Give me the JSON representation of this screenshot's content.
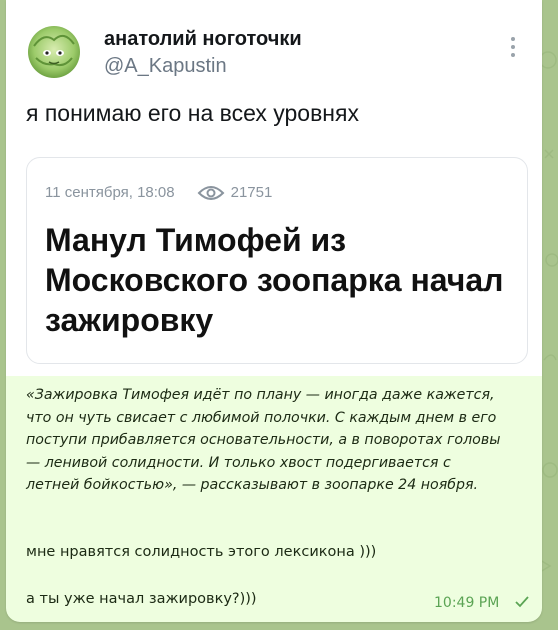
{
  "tweet": {
    "author_name": "анатолий ноготочки",
    "author_handle": "@A_Kapustin",
    "text": "я понимаю его на всех уровнях",
    "news": {
      "date": "11 сентября, 18:08",
      "views": "21751",
      "headline": "Манул Тимофей из Московского зоопарка начал зажировку"
    }
  },
  "message": {
    "quote": "«Зажировка Тимофея идёт по плану — иногда даже кажется, что он чуть свисает с любимой полочки. С каждым днем в его поступи прибавляется основательности, а в поворотах головы — ленивой солидности. И только хвост подергивается с летней бойкостью», — рассказывают в зоопарке 24 ноября.",
    "line1": "мне нравятся солидность этого лексикона )))",
    "line2": "а ты уже начал зажировку?)))",
    "time": "10:49 PM"
  },
  "icons": {
    "avatar": "cabbage-avatar",
    "more": "more-vertical-icon",
    "views": "eye-icon",
    "status": "check-icon"
  },
  "colors": {
    "bubble": "#eefedf",
    "time": "#5ba454",
    "background": "#a9c48d"
  }
}
